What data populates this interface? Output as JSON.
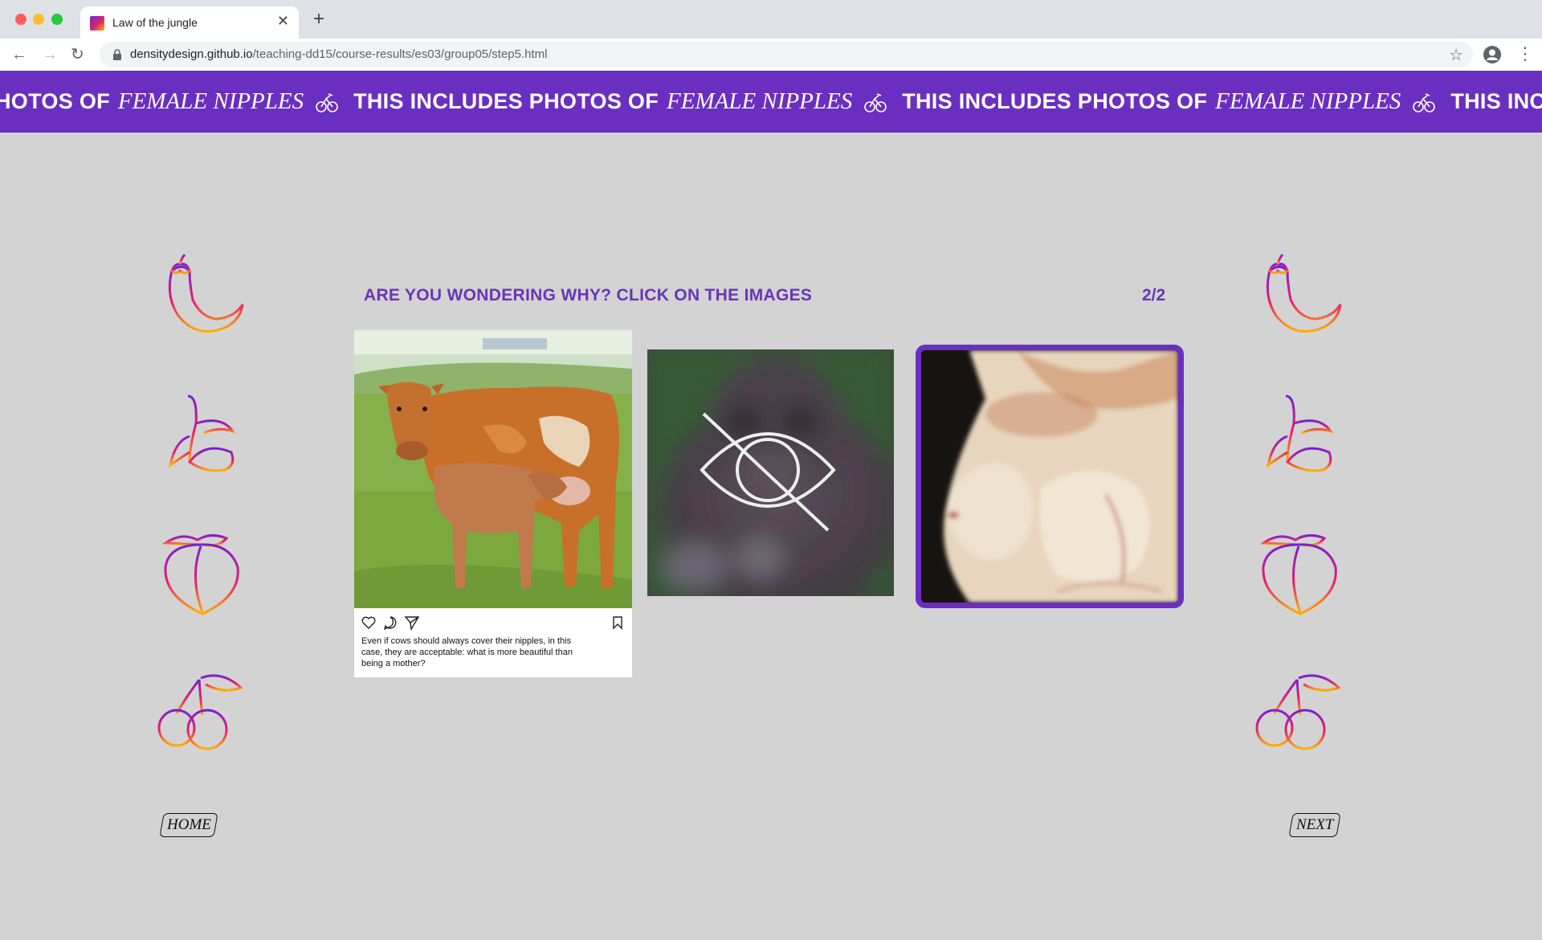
{
  "browser": {
    "tab_title": "Law of the jungle",
    "url_host": "densitydesign.github.io",
    "url_path": "/teaching-dd15/course-results/es03/group05/step5.html"
  },
  "banner": {
    "prefix_cut": "HOTOS OF",
    "bold_text": "THIS INCLUDES PHOTOS OF",
    "italic_text": "FEMALE NIPPLES",
    "tail_cut": "THIS INCL",
    "icon": "bicycle-icon"
  },
  "content": {
    "heading": "ARE YOU WONDERING WHY? CLICK ON THE IMAGES",
    "pager": "2/2",
    "post_caption": "Even if cows should always cover their nipples, in this case, they are acceptable: what is more beautiful than being a mother?",
    "images": [
      {
        "name": "cow-calf-photo"
      },
      {
        "name": "blurred-gorilla-photo",
        "overlay_icon": "eye-slash-icon"
      },
      {
        "name": "breast-photo",
        "selected": true
      }
    ]
  },
  "side_icons": {
    "left": [
      "eggplant-icon",
      "banana-icon",
      "peach-icon",
      "cherry-icon"
    ],
    "right": [
      "eggplant-icon",
      "banana-icon",
      "peach-icon",
      "cherry-icon"
    ]
  },
  "nav": {
    "home_label": "HOME",
    "next_label": "NEXT"
  },
  "colors": {
    "accent": "#6a2fc0",
    "page_bg": "#d3d3d3",
    "gradient_start": "#7a1fd0",
    "gradient_mid": "#e8206e",
    "gradient_end": "#ffb000"
  }
}
